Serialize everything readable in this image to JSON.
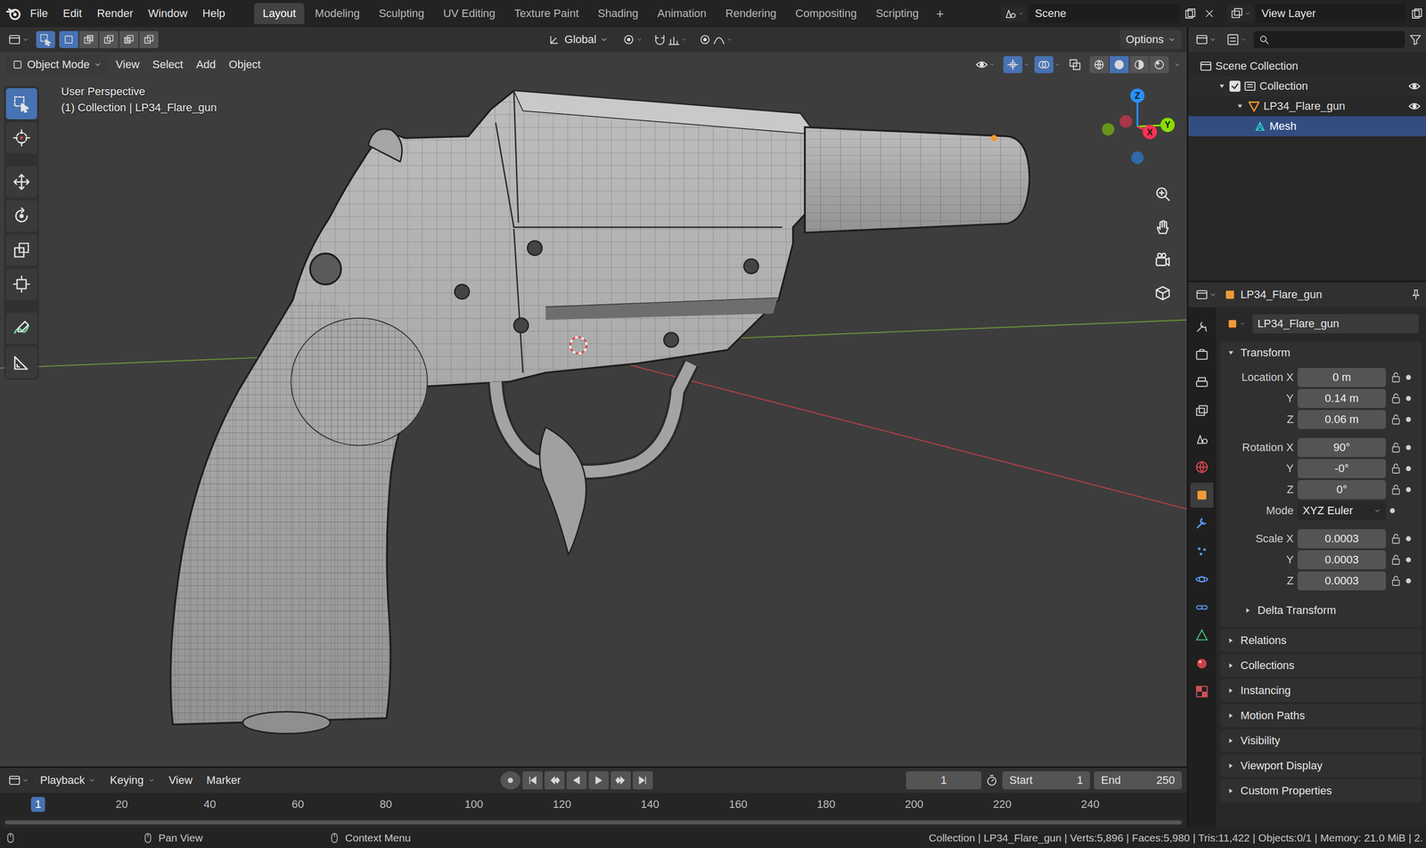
{
  "app_menu": [
    "File",
    "Edit",
    "Render",
    "Window",
    "Help"
  ],
  "workspaces": [
    {
      "label": "Layout",
      "selected": true
    },
    {
      "label": "Modeling",
      "selected": false
    },
    {
      "label": "Sculpting",
      "selected": false
    },
    {
      "label": "UV Editing",
      "selected": false
    },
    {
      "label": "Texture Paint",
      "selected": false
    },
    {
      "label": "Shading",
      "selected": false
    },
    {
      "label": "Animation",
      "selected": false
    },
    {
      "label": "Rendering",
      "selected": false
    },
    {
      "label": "Compositing",
      "selected": false
    },
    {
      "label": "Scripting",
      "selected": false
    }
  ],
  "add_workspace": "+",
  "scene": "Scene",
  "view_layer": "View Layer",
  "tool_header": {
    "select_modes": [
      {
        "selected": true
      },
      {
        "selected": false
      },
      {
        "selected": false
      },
      {
        "selected": false
      },
      {
        "selected": false
      }
    ],
    "orientation": "Global",
    "options": "Options"
  },
  "viewport": {
    "mode": "Object Mode",
    "menus": [
      "View",
      "Select",
      "Add",
      "Object"
    ],
    "perspective": "User Perspective",
    "context": "(1) Collection | LP34_Flare_gun",
    "toggles": [
      {
        "on": true
      },
      {
        "on": true
      },
      {
        "on": false
      }
    ],
    "shading": [
      {
        "selected": false
      },
      {
        "selected": true
      },
      {
        "selected": false
      },
      {
        "selected": false
      }
    ],
    "tools": [
      {
        "selected": true
      },
      {
        "selected": false
      },
      {
        "selected": false
      },
      {
        "selected": false
      },
      {
        "selected": false
      },
      {
        "selected": false
      },
      {
        "selected": false
      },
      {
        "selected": false
      }
    ],
    "axes": [
      {
        "label": "Z",
        "color": "#2890ff"
      },
      {
        "label": "Y",
        "color": "#8bdc00"
      },
      {
        "label": "X",
        "color": "#ff3352"
      }
    ]
  },
  "outliner": {
    "items": [
      {
        "label": "Scene Collection",
        "kind": "scene",
        "depth": 0,
        "selected": false
      },
      {
        "label": "Collection",
        "kind": "collection",
        "depth": 1,
        "expanded": true,
        "checked": true,
        "visible": true,
        "selected": false
      },
      {
        "label": "LP34_Flare_gun",
        "kind": "object",
        "depth": 2,
        "expanded": true,
        "visible": true,
        "selected": false
      },
      {
        "label": "Mesh",
        "kind": "mesh",
        "depth": 3,
        "selected": true
      }
    ]
  },
  "properties": {
    "tabs": [
      {
        "selected": false
      },
      {
        "selected": false
      },
      {
        "selected": false
      },
      {
        "selected": false
      },
      {
        "selected": false
      },
      {
        "selected": false
      },
      {
        "selected": true
      },
      {
        "selected": false
      },
      {
        "selected": false
      },
      {
        "selected": false
      },
      {
        "selected": false
      },
      {
        "selected": false
      },
      {
        "selected": false
      },
      {
        "selected": false
      }
    ],
    "object": "LP34_Flare_gun",
    "datablock": "LP34_Flare_gun",
    "transform": {
      "title": "Transform",
      "expanded": true,
      "groups": [
        [
          {
            "label": "Location X",
            "value": "0 m",
            "kind": "number"
          },
          {
            "label": "Y",
            "value": "0.14 m",
            "kind": "number"
          },
          {
            "label": "Z",
            "value": "0.06 m",
            "kind": "number"
          }
        ],
        [
          {
            "label": "Rotation X",
            "value": "90°",
            "kind": "number"
          },
          {
            "label": "Y",
            "value": "-0°",
            "kind": "number"
          },
          {
            "label": "Z",
            "value": "0°",
            "kind": "number"
          },
          {
            "label": "Mode",
            "value": "XYZ Euler",
            "kind": "dropdown"
          }
        ],
        [
          {
            "label": "Scale X",
            "value": "0.0003",
            "kind": "number"
          },
          {
            "label": "Y",
            "value": "0.0003",
            "kind": "number"
          },
          {
            "label": "Z",
            "value": "0.0003",
            "kind": "number"
          }
        ]
      ]
    },
    "subpanels": [
      {
        "title": "Delta Transform",
        "expanded": false
      }
    ],
    "panels": [
      {
        "title": "Relations",
        "expanded": false
      },
      {
        "title": "Collections",
        "expanded": false
      },
      {
        "title": "Instancing",
        "expanded": false
      },
      {
        "title": "Motion Paths",
        "expanded": false
      },
      {
        "title": "Visibility",
        "expanded": false
      },
      {
        "title": "Viewport Display",
        "expanded": false
      },
      {
        "title": "Custom Properties",
        "expanded": false
      }
    ]
  },
  "timeline": {
    "menus": [
      {
        "label": "Playback",
        "dropdown": true
      },
      {
        "label": "Keying",
        "dropdown": true
      },
      {
        "label": "View",
        "dropdown": false
      },
      {
        "label": "Marker",
        "dropdown": false
      }
    ],
    "frame": "1",
    "start": {
      "label": "Start",
      "value": "1"
    },
    "end": {
      "label": "End",
      "value": "250"
    },
    "ticks": [
      {
        "label": "1",
        "selected": true
      },
      {
        "label": "20",
        "selected": false
      },
      {
        "label": "40",
        "selected": false
      },
      {
        "label": "60",
        "selected": false
      },
      {
        "label": "80",
        "selected": false
      },
      {
        "label": "100",
        "selected": false
      },
      {
        "label": "120",
        "selected": false
      },
      {
        "label": "140",
        "selected": false
      },
      {
        "label": "160",
        "selected": false
      },
      {
        "label": "180",
        "selected": false
      },
      {
        "label": "200",
        "selected": false
      },
      {
        "label": "220",
        "selected": false
      },
      {
        "label": "240",
        "selected": false
      }
    ]
  },
  "status_bar": {
    "hints": [
      {
        "label": "Pan View"
      },
      {
        "label": "Context Menu"
      }
    ],
    "stats": "Collection | LP34_Flare_gun | Verts:5,896 | Faces:5,980 | Tris:11,422 | Objects:0/1 | Memory: 21.0 MiB | 2."
  }
}
